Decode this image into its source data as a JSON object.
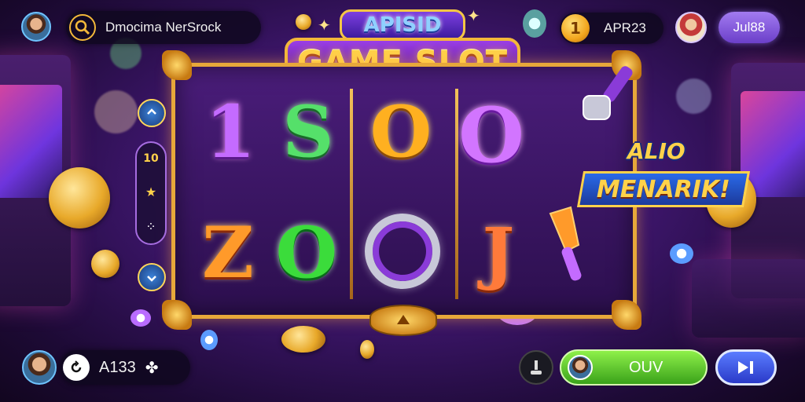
{
  "colors": {
    "accent_gold": "#f3b83a",
    "reel_frame": "#e7a83a",
    "spin_green": "#5ccf2a",
    "play_blue": "#3a52e8",
    "purple_button": "#8a5ae0",
    "badge_blue": "#2458c8"
  },
  "top_left": {
    "search_icon": "search-icon",
    "player_name": "Dmocima NerSrock"
  },
  "title": {
    "top": "APISID",
    "main": "GAME SLOT"
  },
  "top_right": {
    "coin_symbol": "1",
    "balance": "APR23",
    "button_label": "Jul88"
  },
  "reels": {
    "row1": [
      "1",
      "S",
      "O",
      "O"
    ],
    "row2": [
      "Z",
      "O",
      "J"
    ]
  },
  "side_panel": {
    "items": [
      "10",
      "★",
      "⁘"
    ]
  },
  "badge": {
    "top": "ALIO",
    "main": "MENARIK!"
  },
  "bottom_left": {
    "label": "A133",
    "icon": "clover-icon"
  },
  "bottom_right": {
    "spin_label": "OUV"
  }
}
